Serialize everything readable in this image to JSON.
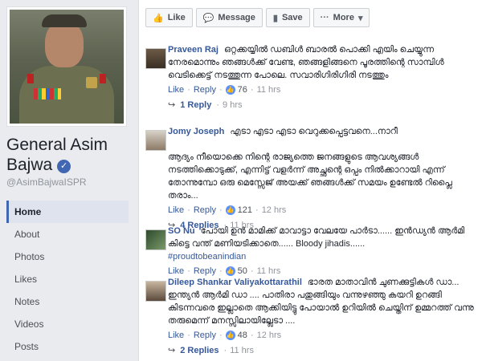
{
  "profile": {
    "name": "General Asim Bajwa",
    "verified_icon": "check-icon",
    "handle": "@AsimBajwaISPR"
  },
  "nav": [
    {
      "label": "Home",
      "active": true
    },
    {
      "label": "About"
    },
    {
      "label": "Photos"
    },
    {
      "label": "Likes"
    },
    {
      "label": "Notes"
    },
    {
      "label": "Videos"
    },
    {
      "label": "Posts"
    }
  ],
  "actions": {
    "like": "Like",
    "message": "Message",
    "save": "Save",
    "more": "More"
  },
  "comments": [
    {
      "author": "Praveen Raj",
      "text": "ഒറ്റക്കയ്യിൽ ഡബിൾ ബാരൽ പൊക്കി എയിം ചെയ്യുന്ന നേരമൊന്നും ഞങ്ങൾക്ക് വേണ്ട, ഞങ്ങളിങ്ങനെ പൂരത്തിന്റെ സാമ്പിൾ വെടിക്കെട്ട് നടത്തുന്ന പോലെ. സവാരിഗിരിഗിരി നടത്തും",
      "tag": "",
      "like": "Like",
      "reply": "Reply",
      "likes": "76",
      "time": "11 hrs",
      "replies": "1 Reply",
      "replies_time": "9 hrs"
    },
    {
      "author": "Jomy Joseph",
      "text": "എടാ എടാ എടാ വെറുക്കപ്പെട്ടവനെ...നാറീ\n\nആദ്യം നീയൊക്കെ നിന്റെ രാജ്യത്തെ ജനങ്ങളുടെ ആവശ്യങ്ങൾ നടത്തിക്കൊടുക്ക്, എന്നിട്ട് വളർന്ന് അച്ഛന്റെ ഒപ്പം നിൽക്കാറായി എന്ന് തോന്നുമ്പോ ഒരു മെസ്സേജ് അയക്ക് ഞങ്ങൾക്ക് സമയം ഉണ്ടേൽ റിപ്ലൈ തരാം...",
      "tag": "",
      "like": "Like",
      "reply": "Reply",
      "likes": "121",
      "time": "12 hrs",
      "replies": "4 Replies",
      "replies_time": "11 hrs"
    },
    {
      "author": "SO Nu",
      "text": "പോയി ഉൻ മാമിക്ക് മാവാട്ടാ വേലയേ പാർടാ...... ഇൻഡ്യൻ ആർമി കിട്ടെ വന്ത് മണിയടിക്കാതെ...... Bloody jihadis......",
      "tag": "#proudtobeanindian",
      "like": "Like",
      "reply": "Reply",
      "likes": "50",
      "time": "11 hrs",
      "replies": "",
      "replies_time": ""
    },
    {
      "author": "Dileep Shankar Valiyakottarathil",
      "text": "ഭാരത മാതാവിൻ ചുണക്കുട്ടികൾ ഡാ... ഇന്ത്യൻ ആർമി ഡാ .... പാതിരാ പതുങ്ങിയും വന്നുഴഞ്ഞു കയറി ഉറങ്ങി കിടന്നവരെ ഇല്ലാതെ ആക്കിയിട്ടു പോയാൽ ഉറിയിൽ ചെയ്തിന് ഉമ്മറത്ത് വന്നു തരുമെന്ന് മനസ്സിലായില്ലേടാ ....",
      "tag": "",
      "like": "Like",
      "reply": "Reply",
      "likes": "48",
      "time": "12 hrs",
      "replies": "2 Replies",
      "replies_time": "11 hrs"
    }
  ]
}
